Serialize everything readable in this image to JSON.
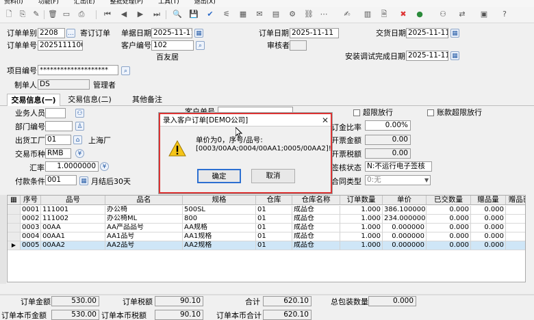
{
  "menu": [
    "资料(I)",
    "功能(F)",
    "汇出(E)",
    "整批处理(P)",
    "工具(T)",
    "退出(X)"
  ],
  "form": {
    "order_type_label": "订单单别",
    "order_type": "2208",
    "order_type_name": "寄订订单",
    "doc_date_label": "单据日期",
    "doc_date": "2025-11-11",
    "order_date_label": "订单日期",
    "order_date": "2025-11-11",
    "delivery_date_label": "交货日期",
    "delivery_date": "2025-11-11",
    "order_no_label": "订单单号",
    "order_no": "20251111001",
    "customer_no_label": "客户编号",
    "customer_no": "102",
    "customer_name": "百友居",
    "reviewer_label": "审核者",
    "install_date_label": "安装调试完成日期",
    "install_date": "2025-11-11",
    "project_label": "项目编号",
    "project_no": "********************",
    "creator_label": "制单人",
    "creator": "DS",
    "creator_name": "管理者"
  },
  "tabs": [
    "交易信息(一)",
    "交易信息(二)",
    "其他备注"
  ],
  "tab1": {
    "salesperson_label": "业务人员",
    "customer_order_label": "客户单号",
    "dept_label": "部门编号",
    "factory_label": "出货工厂",
    "factory": "01",
    "factory_name": "上海厂",
    "currency_label": "交易币种",
    "currency": "RMB",
    "rate_label": "汇率",
    "rate": "1.0000000",
    "payment_label": "付款条件",
    "payment": "001",
    "payment_name": "月结后30天",
    "over_limit_label": "超限放行",
    "acct_over_label": "账款超限放行",
    "deposit_label": "订金比率",
    "deposit": "0.00%",
    "invoice_amt_label": "开票金额",
    "invoice_amt": "0.00",
    "invoice_tax_label": "开票税额",
    "invoice_tax": "0.00",
    "sign_label": "签核状态",
    "sign": "N:不运行电子签核",
    "contract_label": "合同类型",
    "contract": "0:无"
  },
  "grid": {
    "headers": [
      "序号",
      "品号",
      "品名",
      "规格",
      "仓库",
      "仓库名称",
      "订单数量",
      "单价",
      "已交数量",
      "赠品量",
      "赠品已"
    ],
    "rows": [
      [
        "0001",
        "111001",
        "办公椅",
        "500SL",
        "01",
        "成品仓",
        "1.000",
        "386.100000",
        "0.000",
        "0.000",
        ""
      ],
      [
        "0002",
        "111002",
        "办公椅ML",
        "800",
        "01",
        "成品仓",
        "1.000",
        "234.000000",
        "0.000",
        "0.000",
        ""
      ],
      [
        "0003",
        "00AA",
        "AA产品品号",
        "AA规格",
        "01",
        "成品仓",
        "1.000",
        "0.000000",
        "0.000",
        "0.000",
        ""
      ],
      [
        "0004",
        "00AA1",
        "AA1品号",
        "AA1规格",
        "01",
        "成品仓",
        "1.000",
        "0.000000",
        "0.000",
        "0.000",
        ""
      ],
      [
        "0005",
        "00AA2",
        "AA2品号",
        "AA2规格",
        "01",
        "成品仓",
        "1.000",
        "0.000000",
        "0.000",
        "0.000",
        ""
      ]
    ],
    "selected_row": 4
  },
  "footer": {
    "amount_label": "订单金额",
    "amount": "530.00",
    "tax_label": "订单税额",
    "tax": "90.10",
    "total_label": "合计",
    "total": "620.10",
    "pack_label": "总包装数量",
    "pack": "0.000",
    "local_amount_label": "订单本币金额",
    "local_amount": "530.00",
    "local_tax_label": "订单本币税额",
    "local_tax": "90.10",
    "local_total_label": "订单本币合计",
    "local_total": "620.10"
  },
  "dialog": {
    "title": "录入客户订单[DEMO公司]",
    "message1": "单价为0，序号/品号:",
    "message2": "[0003/00AA;0004/00AA1;0005/00AA2]!",
    "ok": "确定",
    "cancel": "取消"
  },
  "colors": {
    "accent_border": "#dd3333",
    "selected_row": "#cfe6f7"
  }
}
